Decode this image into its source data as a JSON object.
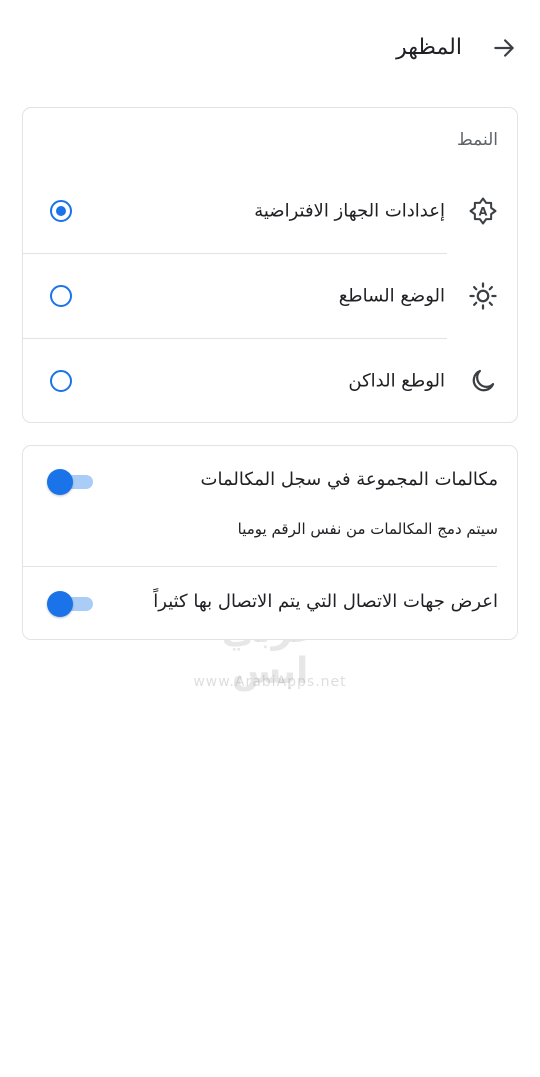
{
  "header": {
    "title": "المظهر",
    "back_icon": "arrow-back-icon"
  },
  "theme": {
    "section_title": "النمط",
    "options": [
      {
        "label": "إعدادات الجهاز الافتراضية",
        "icon": "auto-brightness-icon",
        "selected": true
      },
      {
        "label": "الوضع الساطع",
        "icon": "sun-icon",
        "selected": false
      },
      {
        "label": "الوطع الداكن",
        "icon": "moon-icon",
        "selected": false
      }
    ]
  },
  "settings": {
    "grouped_calls": {
      "title": "مكالمات المجموعة في سجل المكالمات",
      "subtitle": "سيتم دمج المكالمات من نفس الرقم يوميا",
      "enabled": true
    },
    "frequent_contacts": {
      "title": "اعرض جهات الاتصال التي يتم الاتصال بها كثيراً",
      "enabled": true
    }
  },
  "watermark": {
    "text": "عربي ابس",
    "url": "www.ArabiApps.net"
  },
  "colors": {
    "accent": "#1a73e8",
    "track": "#a9cdf7",
    "border": "#e3e3e3"
  }
}
